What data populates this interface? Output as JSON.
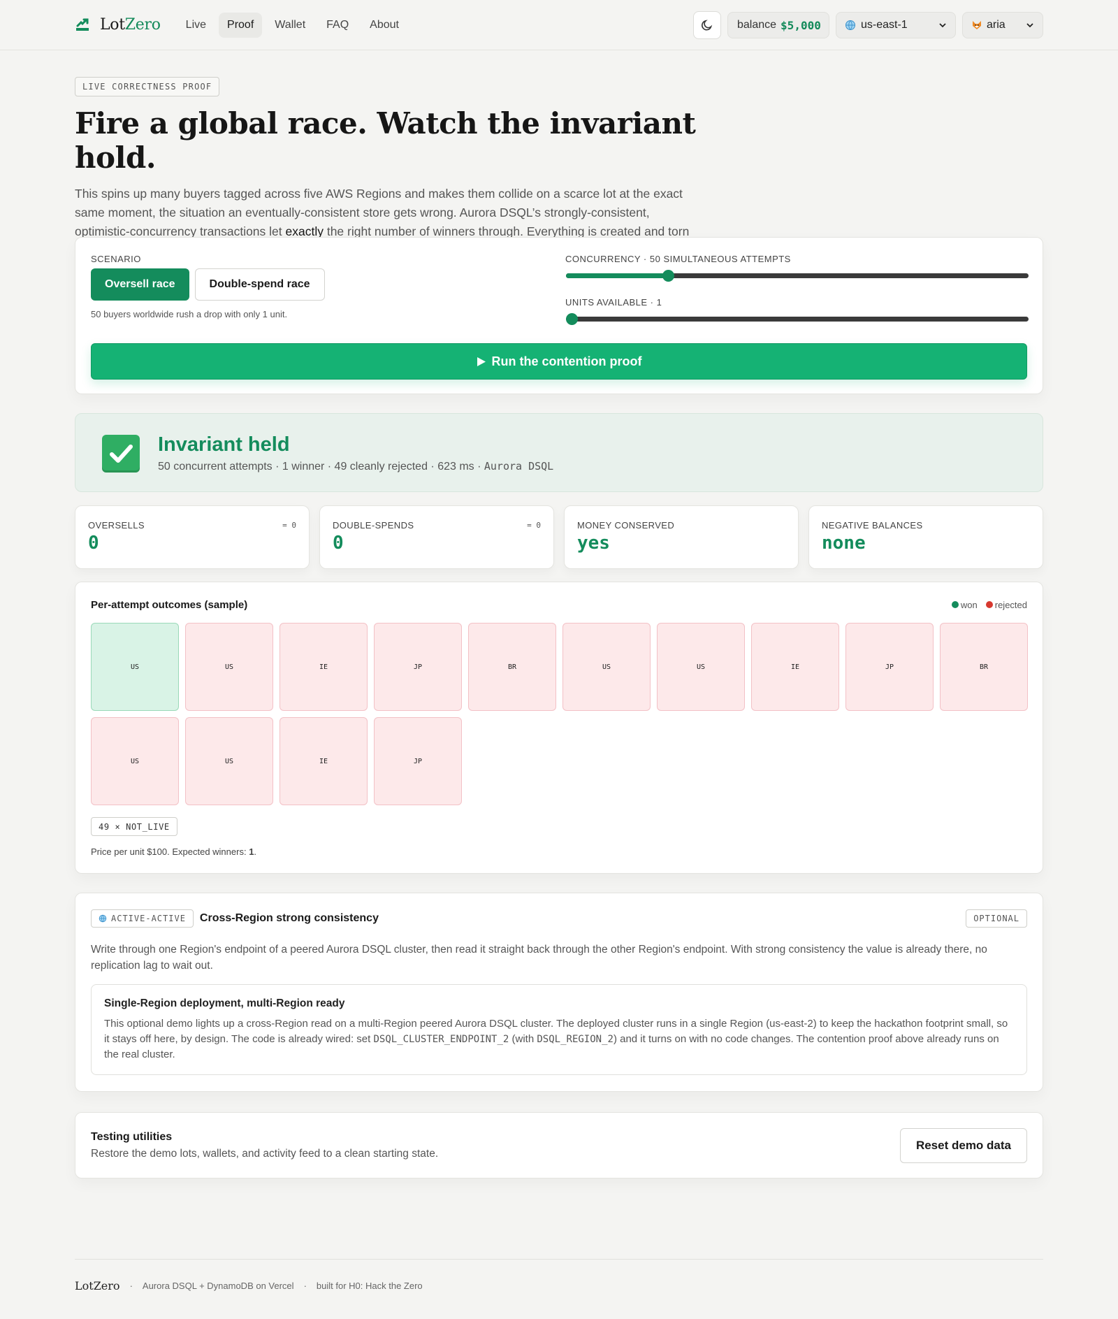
{
  "nav": {
    "brand_lot": "Lot",
    "brand_zero": "Zero",
    "links": [
      "Live",
      "Proof",
      "Wallet",
      "FAQ",
      "About"
    ],
    "active": "Proof",
    "balance_label": "balance",
    "balance_value": "$5,000",
    "region": "us-east-1",
    "user": "aria"
  },
  "hero": {
    "eyebrow": "LIVE CORRECTNESS PROOF",
    "title": "Fire a global race. Watch the invariant hold.",
    "desc_before": "This spins up many buyers tagged across five AWS Regions and makes them collide on a scarce lot at the exact same moment, the situation an eventually-consistent store gets wrong. Aurora DSQL’s strongly-consistent, optimistic-concurrency transactions let ",
    "desc_bold": "exactly",
    "desc_after": " the right number of winners through. Everything is created and torn down per run."
  },
  "scenario": {
    "label": "SCENARIO",
    "btn_oversell": "Oversell race",
    "btn_double": "Double-spend race",
    "hint": "50 buyers worldwide rush a drop with only 1 unit.",
    "concurrency_label": "CONCURRENCY · 50 SIMULTANEOUS ATTEMPTS",
    "concurrency_fraction": 0.22,
    "units_label": "UNITS AVAILABLE · 1",
    "units_fraction": 0.0,
    "run_label": "Run the contention proof"
  },
  "invariant": {
    "title": "Invariant held",
    "sub": "50 concurrent attempts · 1 winner · 49 cleanly rejected · 623 ms · ",
    "engine": "Aurora DSQL"
  },
  "stats": [
    {
      "label": "OVERSELLS",
      "eq": "= 0",
      "value": "0",
      "mono": true
    },
    {
      "label": "DOUBLE-SPENDS",
      "eq": "= 0",
      "value": "0",
      "mono": true
    },
    {
      "label": "MONEY CONSERVED",
      "eq": "",
      "value": "yes",
      "mono": false
    },
    {
      "label": "NEGATIVE BALANCES",
      "eq": "",
      "value": "none",
      "mono": false
    }
  ],
  "outcomes": {
    "title": "Per-attempt outcomes (sample)",
    "legend_won": "won",
    "legend_rejected": "rejected",
    "tiles": [
      {
        "region": "US",
        "status": "won"
      },
      {
        "region": "US",
        "status": "rejected"
      },
      {
        "region": "IE",
        "status": "rejected"
      },
      {
        "region": "JP",
        "status": "rejected"
      },
      {
        "region": "BR",
        "status": "rejected"
      },
      {
        "region": "US",
        "status": "rejected"
      },
      {
        "region": "US",
        "status": "rejected"
      },
      {
        "region": "IE",
        "status": "rejected"
      },
      {
        "region": "JP",
        "status": "rejected"
      },
      {
        "region": "BR",
        "status": "rejected"
      },
      {
        "region": "US",
        "status": "rejected"
      },
      {
        "region": "US",
        "status": "rejected"
      },
      {
        "region": "IE",
        "status": "rejected"
      },
      {
        "region": "JP",
        "status": "rejected"
      }
    ],
    "code": "49 × NOT_LIVE",
    "price_before": "Price per unit $100. Expected winners: ",
    "price_bold": "1",
    "price_after": "."
  },
  "cross": {
    "chip": "ACTIVE-ACTIVE",
    "title": "Cross-Region strong consistency",
    "optional": "OPTIONAL",
    "desc": "Write through one Region's endpoint of a peered Aurora DSQL cluster, then read it straight back through the other Region's endpoint. With strong consistency the value is already there, no replication lag to wait out.",
    "box_title": "Single-Region deployment, multi-Region ready",
    "box_p1": "This optional demo lights up a cross-Region read on a multi-Region peered Aurora DSQL cluster. The deployed cluster runs in a single Region (us-east-2) to keep the hackathon footprint small, so it stays off here, by design. The code is already wired: set ",
    "box_code1": "DSQL_CLUSTER_ENDPOINT_2",
    "box_p2": " (with ",
    "box_code2": "DSQL_REGION_2",
    "box_p3": ") and it turns on with no code changes. The contention proof above already runs on the real cluster."
  },
  "testing": {
    "title": "Testing utilities",
    "desc": "Restore the demo lots, wallets, and activity feed to a clean starting state.",
    "button": "Reset demo data"
  },
  "footer": {
    "brand": "LotZero",
    "stack": "Aurora DSQL + DynamoDB on Vercel",
    "built": "built for H0: Hack the Zero"
  },
  "colors": {
    "accent": "#148c5c",
    "run": "#15b274",
    "won_bg": "#d9f3e6",
    "rejected_bg": "#fde9ea",
    "won_dot": "#148c5c",
    "rejected_dot": "#d7392f"
  },
  "icons": {
    "brand": "stairs-logo-icon",
    "theme": "moon-icon",
    "region": "globe-icon",
    "user": "fox-avatar-icon",
    "run": "play-icon",
    "invariant": "check-icon"
  }
}
